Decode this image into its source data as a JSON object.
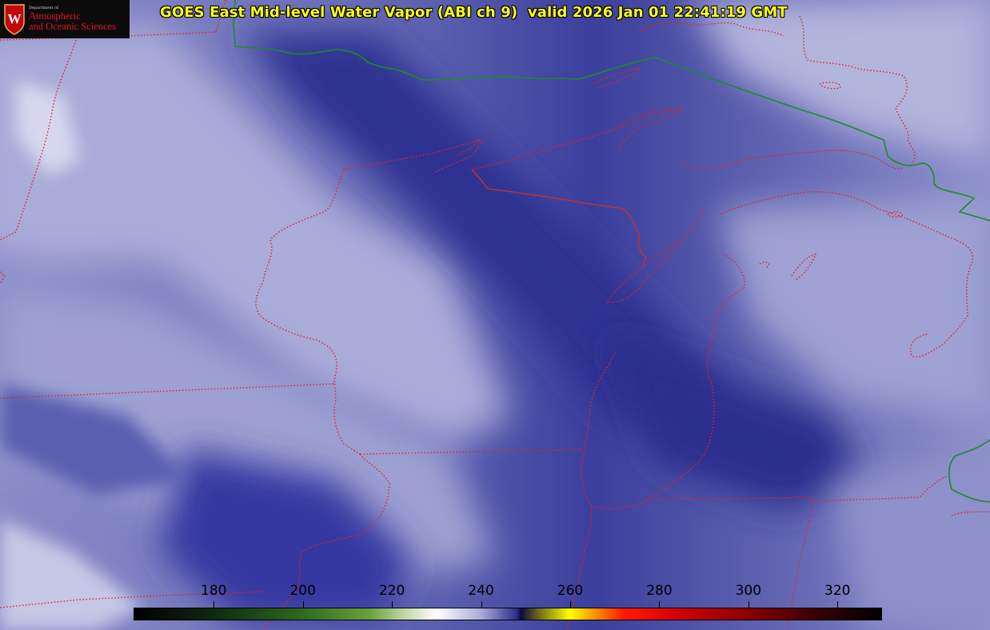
{
  "title": "GOES East Mid-level Water Vapor (ABI ch 9)  valid 2026 Jan 01 22:41:19 GMT",
  "logo": {
    "dept": "Department of",
    "line1": "Atmospheric",
    "line2": "and Oceanic Sciences",
    "crest_letter": "W"
  },
  "colorbar": {
    "ticks": [
      "180",
      "200",
      "220",
      "240",
      "260",
      "280",
      "300",
      "320"
    ],
    "range": [
      162,
      330
    ],
    "stops": [
      {
        "value": 162,
        "color": "#000000"
      },
      {
        "value": 180,
        "color": "#0f2a10"
      },
      {
        "value": 200,
        "color": "#2d6b1e"
      },
      {
        "value": 215,
        "color": "#6aa03c"
      },
      {
        "value": 222,
        "color": "#b9d29c"
      },
      {
        "value": 230,
        "color": "#ffffff"
      },
      {
        "value": 240,
        "color": "#a9abd6"
      },
      {
        "value": 248,
        "color": "#2b2f8a"
      },
      {
        "value": 249,
        "color": "#0a0b40"
      },
      {
        "value": 253,
        "color": "#6f6a1a"
      },
      {
        "value": 260,
        "color": "#ffff00"
      },
      {
        "value": 266,
        "color": "#ff8a00"
      },
      {
        "value": 272,
        "color": "#ff1a00"
      },
      {
        "value": 285,
        "color": "#d00000"
      },
      {
        "value": 300,
        "color": "#8a0000"
      },
      {
        "value": 315,
        "color": "#3a0000"
      },
      {
        "value": 330,
        "color": "#000000"
      }
    ]
  },
  "colors": {
    "state_borders": "#e8202a",
    "country_border": "#1f8a2a",
    "title": "#ffff1a"
  }
}
